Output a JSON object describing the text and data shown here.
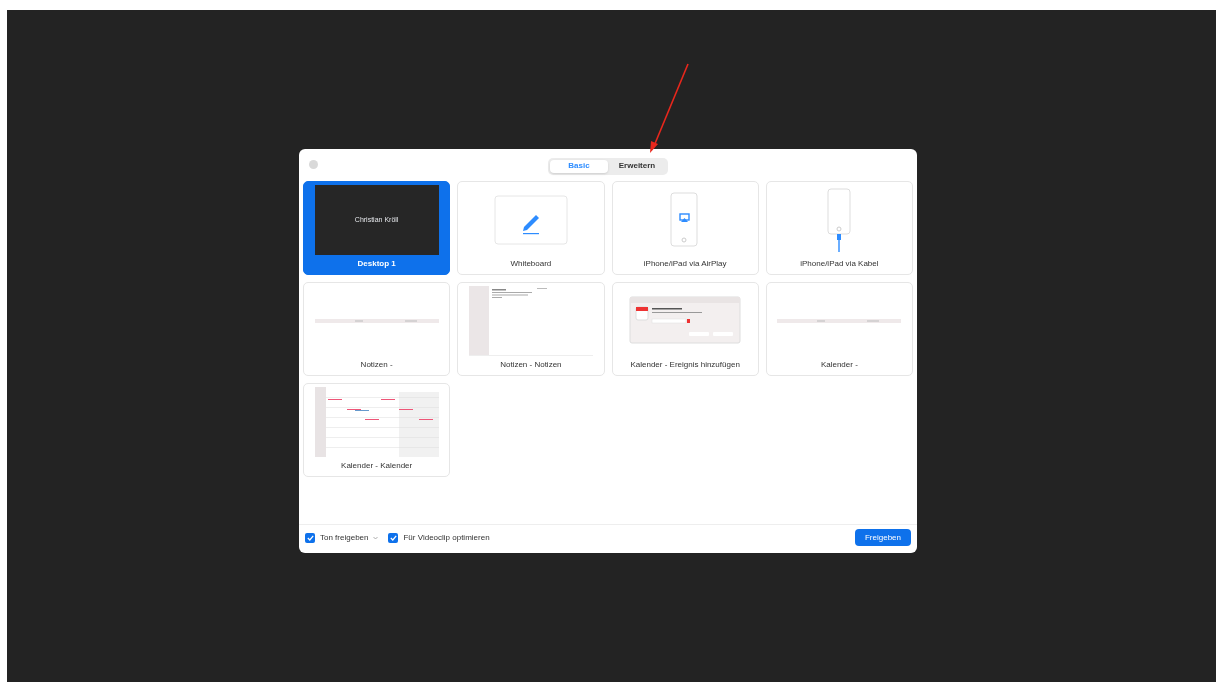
{
  "tabs": [
    {
      "label": "Basic",
      "selected": true
    },
    {
      "label": "Erweitern",
      "selected": false
    }
  ],
  "sources": [
    {
      "label": "Desktop 1",
      "kind": "desktop",
      "selected": true,
      "preview_text": "Christian Kröll"
    },
    {
      "label": "Whiteboard",
      "kind": "whiteboard",
      "selected": false
    },
    {
      "label": "iPhone/iPad via AirPlay",
      "kind": "airplay",
      "selected": false
    },
    {
      "label": "iPhone/iPad via Kabel",
      "kind": "cable",
      "selected": false
    },
    {
      "label": "Notizen -",
      "kind": "strip",
      "selected": false
    },
    {
      "label": "Notizen - Notizen",
      "kind": "notes",
      "selected": false
    },
    {
      "label": "Kalender - Ereignis hinzufügen",
      "kind": "dialog",
      "selected": false
    },
    {
      "label": "Kalender -",
      "kind": "strip",
      "selected": false
    },
    {
      "label": "Kalender - Kalender",
      "kind": "calendar",
      "selected": false
    }
  ],
  "options": [
    {
      "label": "Ton freigeben",
      "checked": true,
      "dropdown": true
    },
    {
      "label": "Für Videoclip optimieren",
      "checked": true,
      "dropdown": false
    }
  ],
  "share_button": "Freigeben"
}
